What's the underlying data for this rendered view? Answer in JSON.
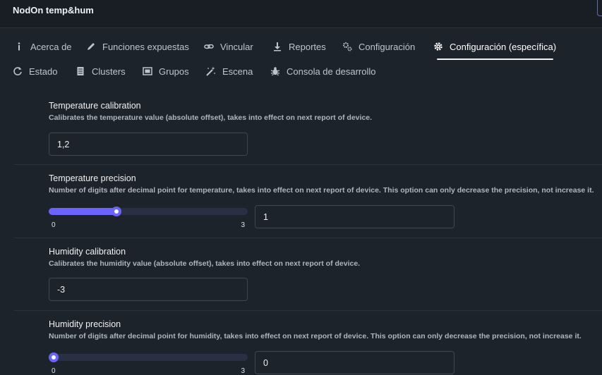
{
  "window": {
    "title": "NodOn temp&hum"
  },
  "tabs": [
    {
      "label": "Acerca de",
      "icon": "info-icon"
    },
    {
      "label": "Funciones expuestas",
      "icon": "pencil-icon"
    },
    {
      "label": "Vincular",
      "icon": "link-icon"
    },
    {
      "label": "Reportes",
      "icon": "download-icon"
    },
    {
      "label": "Configuración",
      "icon": "gears-icon"
    },
    {
      "label": "Configuración (específica)",
      "icon": "gear-icon",
      "active": true
    },
    {
      "label": "Estado",
      "icon": "refresh-icon"
    },
    {
      "label": "Clusters",
      "icon": "list-icon"
    },
    {
      "label": "Grupos",
      "icon": "group-icon"
    },
    {
      "label": "Escena",
      "icon": "magic-wand-icon"
    },
    {
      "label": "Consola de desarrollo",
      "icon": "bug-icon"
    }
  ],
  "settings": {
    "temperature_calibration": {
      "title": "Temperature calibration",
      "description": "Calibrates the temperature value (absolute offset), takes into effect on next report of device.",
      "value": "1,2"
    },
    "temperature_precision": {
      "title": "Temperature precision",
      "description": "Number of digits after decimal point for temperature, takes into effect on next report of device. This option can only decrease the precision, not increase it.",
      "min": "0",
      "max": "3",
      "level": 1,
      "value": "1"
    },
    "humidity_calibration": {
      "title": "Humidity calibration",
      "description": "Calibrates the humidity value (absolute offset), takes into effect on next report of device.",
      "value": "-3"
    },
    "humidity_precision": {
      "title": "Humidity precision",
      "description": "Number of digits after decimal point for humidity, takes into effect on next report of device. This option can only decrease the precision, not increase it.",
      "min": "0",
      "max": "3",
      "level": 0,
      "value": "0"
    }
  },
  "colors": {
    "background": "#1d232a",
    "accent": "#6b63ff",
    "track": "#293044"
  }
}
